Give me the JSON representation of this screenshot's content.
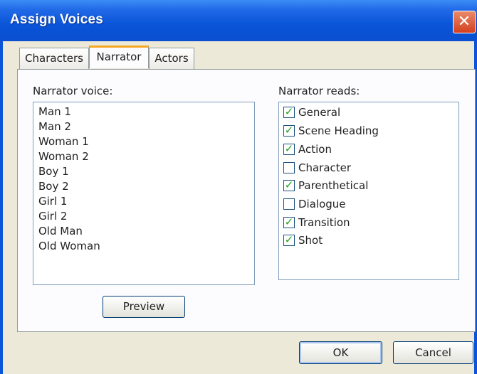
{
  "window": {
    "title": "Assign Voices",
    "close_symbol": "✕"
  },
  "tabs": [
    {
      "label": "Characters",
      "active": false
    },
    {
      "label": "Narrator",
      "active": true
    },
    {
      "label": "Actors",
      "active": false
    }
  ],
  "narrator_voice": {
    "label": "Narrator voice:",
    "items": [
      "Man 1",
      "Man 2",
      "Woman 1",
      "Woman 2",
      "Boy 1",
      "Boy 2",
      "Girl 1",
      "Girl 2",
      "Old Man",
      "Old Woman"
    ]
  },
  "narrator_reads": {
    "label": "Narrator reads:",
    "items": [
      {
        "label": "General",
        "checked": true
      },
      {
        "label": "Scene Heading",
        "checked": true
      },
      {
        "label": "Action",
        "checked": true
      },
      {
        "label": "Character",
        "checked": false
      },
      {
        "label": "Parenthetical",
        "checked": true
      },
      {
        "label": "Dialogue",
        "checked": false
      },
      {
        "label": "Transition",
        "checked": true
      },
      {
        "label": "Shot",
        "checked": true
      }
    ]
  },
  "buttons": {
    "preview": "Preview",
    "ok": "OK",
    "cancel": "Cancel"
  },
  "colors": {
    "titlebar": "#0a54d8",
    "check": "#21a121",
    "active_tab_accent": "#f5a623"
  }
}
